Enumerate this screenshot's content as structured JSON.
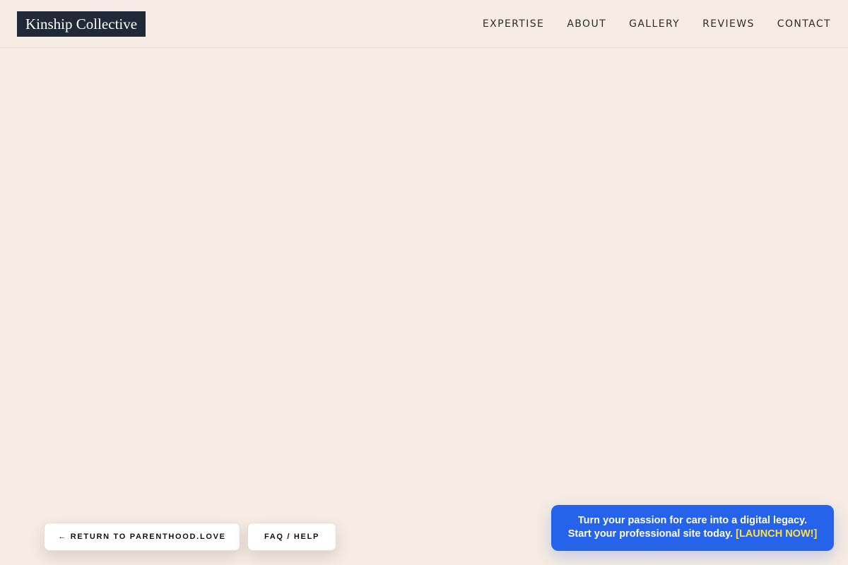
{
  "header": {
    "brand": "Kinship Collective",
    "nav": [
      "EXPERTISE",
      "ABOUT",
      "GALLERY",
      "REVIEWS",
      "CONTACT"
    ]
  },
  "footer_buttons": {
    "return_label": "← RETURN TO PARENTHOOD.LOVE",
    "faq_label": "FAQ / HELP"
  },
  "promo": {
    "line1": "Turn your passion for care into a digital legacy.",
    "line2": "Start your professional site today.",
    "cta": "[LAUNCH NOW!]"
  },
  "colors": {
    "background": "#f6ece3",
    "brand_bg": "#1f2937",
    "promo_bg": "#2563eb",
    "promo_cta": "#fde047"
  }
}
